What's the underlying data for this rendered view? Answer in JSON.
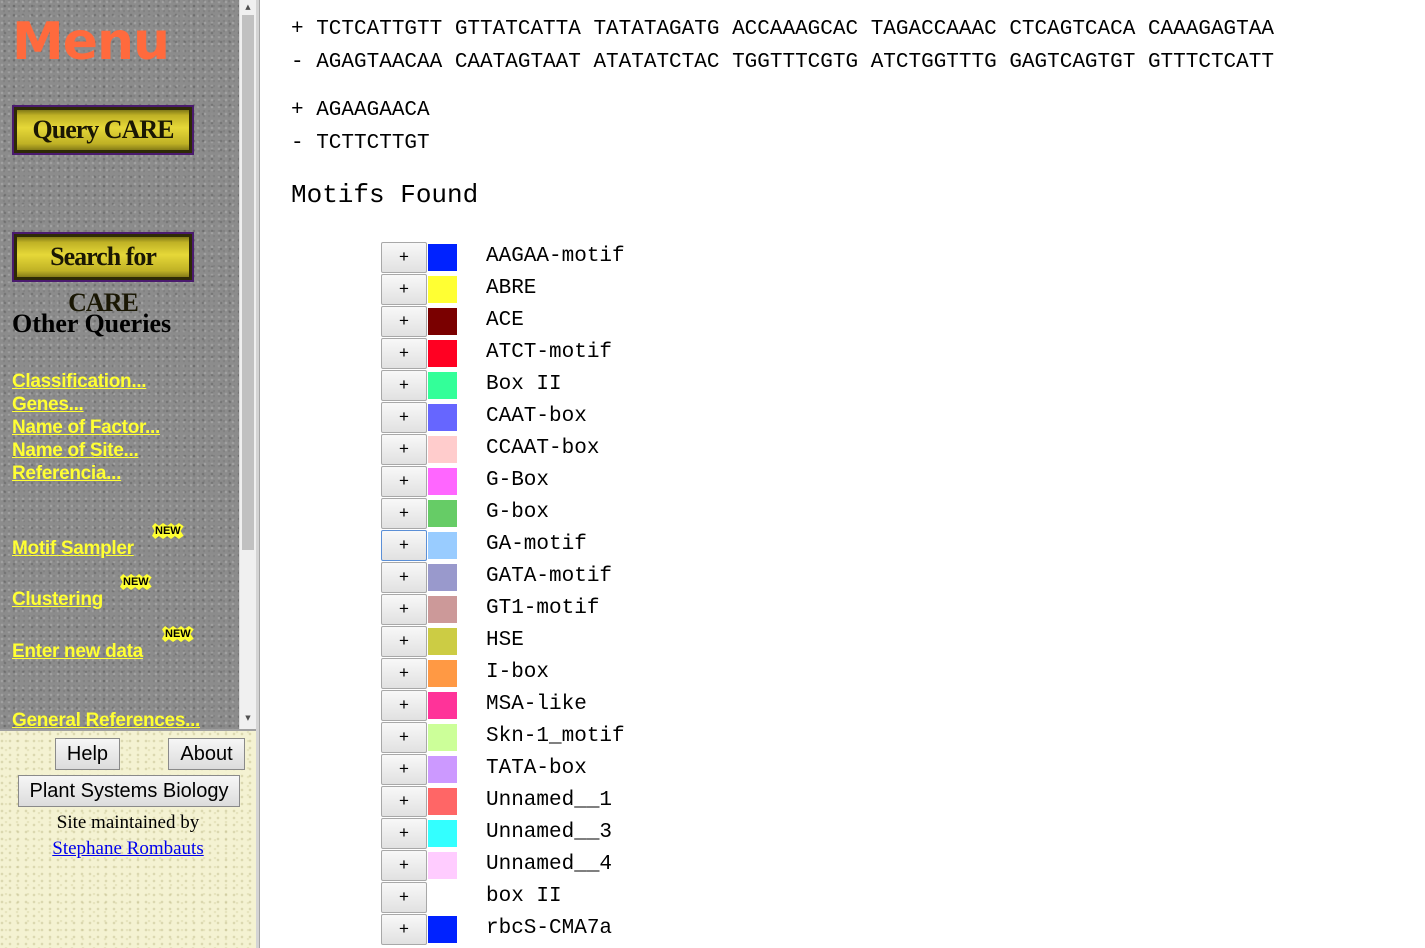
{
  "menu": {
    "title": "Menu",
    "query_button": "Query CARE",
    "search_button": "Search for CARE",
    "other_queries_heading": "Other Queries",
    "query_links": [
      "Classification...",
      "Genes...",
      "Name of Factor...",
      "Name of Site...",
      "Referencia..."
    ],
    "motif_sampler": "Motif Sampler",
    "clustering": "Clustering",
    "enter_new_data": "Enter new data",
    "new_badge": "NEW",
    "general_references": "General References..."
  },
  "info": {
    "help": "Help",
    "about": "About",
    "plant_systems_biology": "Plant Systems Biology",
    "maintained_by": "Site maintained by",
    "maintainer": "Stephane Rombauts"
  },
  "sequence": {
    "plus_line_1": "+ TCTCATTGTT GTTATCATTA TATATAGATG ACCAAAGCAC TAGACCAAAC CTCAGTCACA CAAAGAGTAA",
    "minus_line_1": "- AGAGTAACAA CAATAGTAAT ATATATCTAC TGGTTTCGTG ATCTGGTTTG GAGTCAGTGT GTTTCTCATT",
    "plus_line_2": "+ AGAAGAACA",
    "minus_line_2": "- TCTTCTTGT"
  },
  "motifs_heading": "Motifs Found",
  "expand_label": "+",
  "motifs": [
    {
      "name": "AAGAA-motif",
      "color": "#0022ff"
    },
    {
      "name": "ABRE",
      "color": "#ffff33"
    },
    {
      "name": "ACE",
      "color": "#7a0000"
    },
    {
      "name": "ATCT-motif",
      "color": "#ff0022"
    },
    {
      "name": "Box II",
      "color": "#33ff99"
    },
    {
      "name": "CAAT-box",
      "color": "#6666ff"
    },
    {
      "name": "CCAAT-box",
      "color": "#ffcccc"
    },
    {
      "name": "G-Box",
      "color": "#ff66ff"
    },
    {
      "name": "G-box",
      "color": "#66cc66"
    },
    {
      "name": "GA-motif",
      "color": "#99ccff"
    },
    {
      "name": "GATA-motif",
      "color": "#9999cc"
    },
    {
      "name": "GT1-motif",
      "color": "#cc9999"
    },
    {
      "name": "HSE",
      "color": "#cccc44"
    },
    {
      "name": "I-box",
      "color": "#ff9944"
    },
    {
      "name": "MSA-like",
      "color": "#ff3399"
    },
    {
      "name": "Skn-1_motif",
      "color": "#ccff99"
    },
    {
      "name": "TATA-box",
      "color": "#cc99ff"
    },
    {
      "name": "Unnamed__1",
      "color": "#ff6666"
    },
    {
      "name": "Unnamed__3",
      "color": "#33ffff"
    },
    {
      "name": "Unnamed__4",
      "color": "#ffccff"
    },
    {
      "name": "box II",
      "color": "#ffffff"
    },
    {
      "name": "rbcS-CMA7a",
      "color": "#0022ff"
    }
  ]
}
